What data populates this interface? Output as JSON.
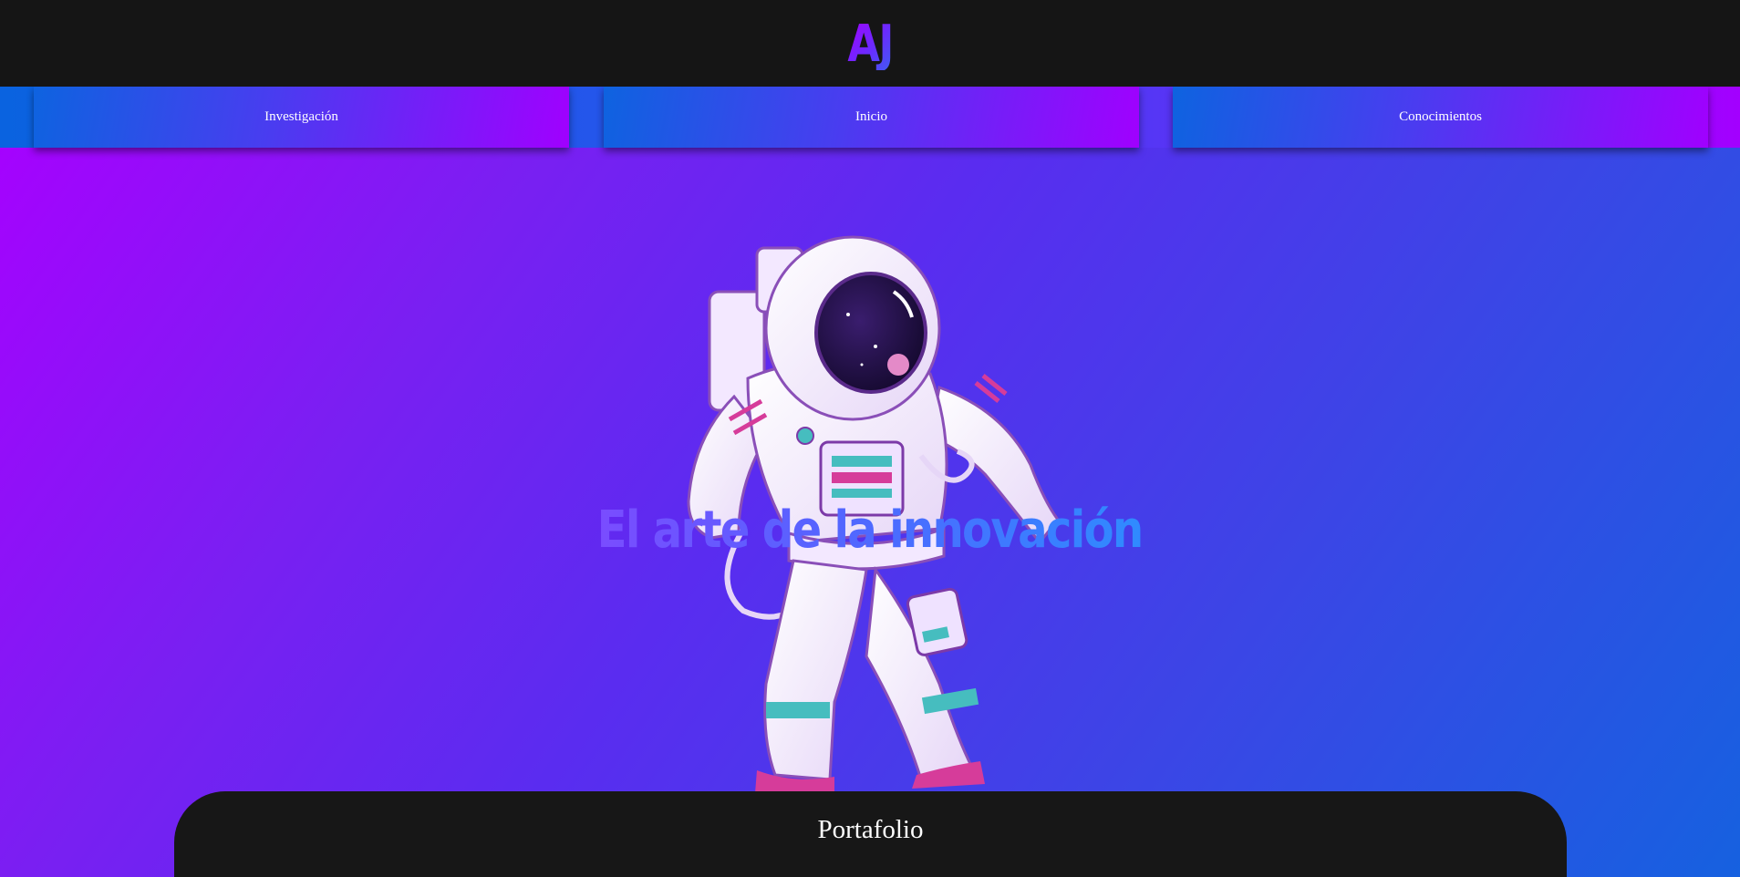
{
  "header": {
    "logo_text": "AJ"
  },
  "nav": {
    "items": [
      {
        "label": "Investigación"
      },
      {
        "label": "Inicio"
      },
      {
        "label": "Conocimientos"
      }
    ]
  },
  "hero": {
    "headline": "El arte de la innovación",
    "image_alt": "astronaut-illustration"
  },
  "portfolio": {
    "title": "Portafolio"
  },
  "colors": {
    "header_bg": "#151515",
    "gradient_start": "#a800ff",
    "gradient_end": "#1661e0",
    "card_bg": "#171717",
    "text": "#ffffff"
  }
}
